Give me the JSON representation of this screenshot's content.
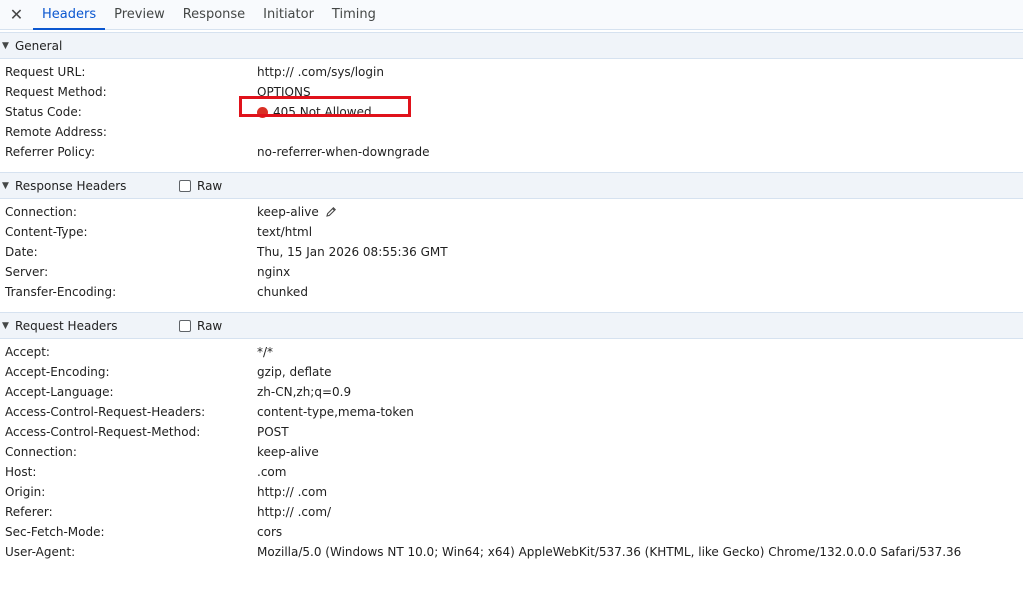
{
  "tabs": {
    "close_icon": "✕",
    "items": [
      "Headers",
      "Preview",
      "Response",
      "Initiator",
      "Timing"
    ],
    "active": "Headers"
  },
  "general": {
    "title": "General",
    "rows": [
      {
        "key": "Request URL:",
        "value": "http://   .com/sys/login"
      },
      {
        "key": "Request Method:",
        "value": "OPTIONS"
      },
      {
        "key": "Status Code:",
        "value": "405 Not Allowed"
      },
      {
        "key": "Remote Address:",
        "value": ""
      },
      {
        "key": "Referrer Policy:",
        "value": "no-referrer-when-downgrade"
      }
    ]
  },
  "response_headers": {
    "title": "Response Headers",
    "raw_label": "Raw",
    "rows": [
      {
        "key": "Connection:",
        "value": "keep-alive"
      },
      {
        "key": "Content-Type:",
        "value": "text/html"
      },
      {
        "key": "Date:",
        "value": "Thu, 15 Jan 2026 08:55:36 GMT"
      },
      {
        "key": "Server:",
        "value": "nginx"
      },
      {
        "key": "Transfer-Encoding:",
        "value": "chunked"
      }
    ]
  },
  "request_headers": {
    "title": "Request Headers",
    "raw_label": "Raw",
    "rows": [
      {
        "key": "Accept:",
        "value": "*/*"
      },
      {
        "key": "Accept-Encoding:",
        "value": "gzip, deflate"
      },
      {
        "key": "Accept-Language:",
        "value": "zh-CN,zh;q=0.9"
      },
      {
        "key": "Access-Control-Request-Headers:",
        "value": "content-type,mema-token"
      },
      {
        "key": "Access-Control-Request-Method:",
        "value": "POST"
      },
      {
        "key": "Connection:",
        "value": "keep-alive"
      },
      {
        "key": "Host:",
        "value": "   .com"
      },
      {
        "key": "Origin:",
        "value": "http://   .com"
      },
      {
        "key": "Referer:",
        "value": "http://   .com/"
      },
      {
        "key": "Sec-Fetch-Mode:",
        "value": "cors"
      },
      {
        "key": "User-Agent:",
        "value": "Mozilla/5.0 (Windows NT 10.0; Win64; x64) AppleWebKit/537.36 (KHTML, like Gecko) Chrome/132.0.0.0 Safari/537.36"
      }
    ]
  },
  "colors": {
    "accent": "#0b57d0",
    "status_error": "#d93025",
    "highlight": "#e0121b"
  },
  "icons": {
    "close": "close-icon",
    "collapse": "triangle-down-icon",
    "edit": "pencil-icon"
  }
}
